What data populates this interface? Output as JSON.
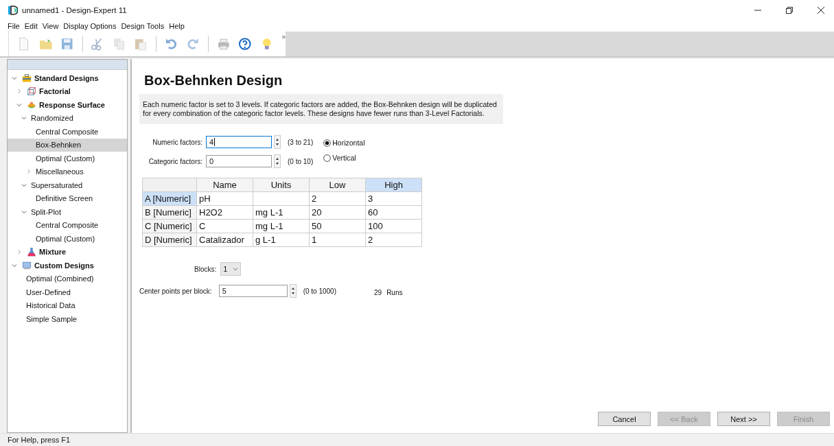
{
  "window": {
    "title": "unnamed1 - Design-Expert 11"
  },
  "menu": [
    "File",
    "Edit",
    "View",
    "Display Options",
    "Design Tools",
    "Help"
  ],
  "toolbar_overflow": "»",
  "tree": [
    {
      "label": "Standard Designs",
      "kind": "category",
      "expanded": true,
      "selected": false,
      "children": [
        {
          "label": "Factorial",
          "kind": "category",
          "expanded": false,
          "selected": false
        },
        {
          "label": "Response Surface",
          "kind": "category",
          "expanded": true,
          "selected": false,
          "children": [
            {
              "label": "Randomized",
              "kind": "item",
              "expanded": true,
              "selected": false,
              "children": [
                {
                  "label": "Central Composite",
                  "kind": "item",
                  "selected": false
                },
                {
                  "label": "Box-Behnken",
                  "kind": "item",
                  "selected": true
                },
                {
                  "label": "Optimal (Custom)",
                  "kind": "item",
                  "selected": false
                },
                {
                  "label": "Miscellaneous",
                  "kind": "item",
                  "expanded": false,
                  "selected": false
                }
              ]
            },
            {
              "label": "Supersaturated",
              "kind": "item",
              "expanded": true,
              "selected": false,
              "children": [
                {
                  "label": "Definitive Screen",
                  "kind": "item",
                  "selected": false
                }
              ]
            },
            {
              "label": "Split-Plot",
              "kind": "item",
              "expanded": true,
              "selected": false,
              "children": [
                {
                  "label": "Central Composite",
                  "kind": "item",
                  "selected": false
                },
                {
                  "label": "Optimal (Custom)",
                  "kind": "item",
                  "selected": false
                }
              ]
            }
          ]
        },
        {
          "label": "Mixture",
          "kind": "category",
          "expanded": false,
          "selected": false
        }
      ]
    },
    {
      "label": "Custom Designs",
      "kind": "category",
      "expanded": true,
      "selected": false,
      "children": [
        {
          "label": "Optimal (Combined)",
          "kind": "item",
          "selected": false
        },
        {
          "label": "User-Defined",
          "kind": "item",
          "selected": false
        },
        {
          "label": "Historical Data",
          "kind": "item",
          "selected": false
        },
        {
          "label": "Simple Sample",
          "kind": "item",
          "selected": false
        }
      ]
    }
  ],
  "heading": "Box-Behnken Design",
  "description": "Each numeric factor is set to 3 levels. If categoric factors are added, the Box-Behnken design will be duplicated for every combination of the categoric factor levels. These designs have fewer runs than 3-Level Factorials.",
  "factor_fields": [
    {
      "label": "Numeric factors:",
      "value": "4",
      "range": "(3 to 21)",
      "focused": true
    },
    {
      "label": "Categoric factors:",
      "value": "0",
      "range": "(0 to 10)",
      "focused": false
    }
  ],
  "orientation": [
    {
      "label": "Horizontal",
      "selected": true
    },
    {
      "label": "Vertical",
      "selected": false
    }
  ],
  "table": {
    "columns": [
      {
        "label": "Name",
        "selected": false
      },
      {
        "label": "Units",
        "selected": false
      },
      {
        "label": "Low",
        "selected": false
      },
      {
        "label": "High",
        "selected": true
      }
    ],
    "rows": [
      {
        "header": "A [Numeric]",
        "selected": true,
        "cells": [
          "pH",
          "",
          "2",
          "3"
        ]
      },
      {
        "header": "B [Numeric]",
        "selected": false,
        "cells": [
          "H2O2",
          "mg L-1",
          "20",
          "60"
        ]
      },
      {
        "header": "C [Numeric]",
        "selected": false,
        "cells": [
          "C",
          "mg L-1",
          "50",
          "100"
        ]
      },
      {
        "header": "D [Numeric]",
        "selected": false,
        "cells": [
          "Catalizador",
          "g L-1",
          "1",
          "2"
        ]
      }
    ]
  },
  "blocks": {
    "label": "Blocks:",
    "value": "1"
  },
  "center_points": {
    "label": "Center points per block:",
    "value": "5",
    "range": "(0 to 1000)"
  },
  "runs": {
    "count": "29",
    "label": "Runs"
  },
  "buttons": [
    {
      "label": "Cancel",
      "disabled": false
    },
    {
      "label": "<< Back",
      "disabled": true
    },
    {
      "label": "Next >>",
      "disabled": false
    },
    {
      "label": "Finish",
      "disabled": true
    }
  ],
  "status_bar": "For Help, press F1"
}
